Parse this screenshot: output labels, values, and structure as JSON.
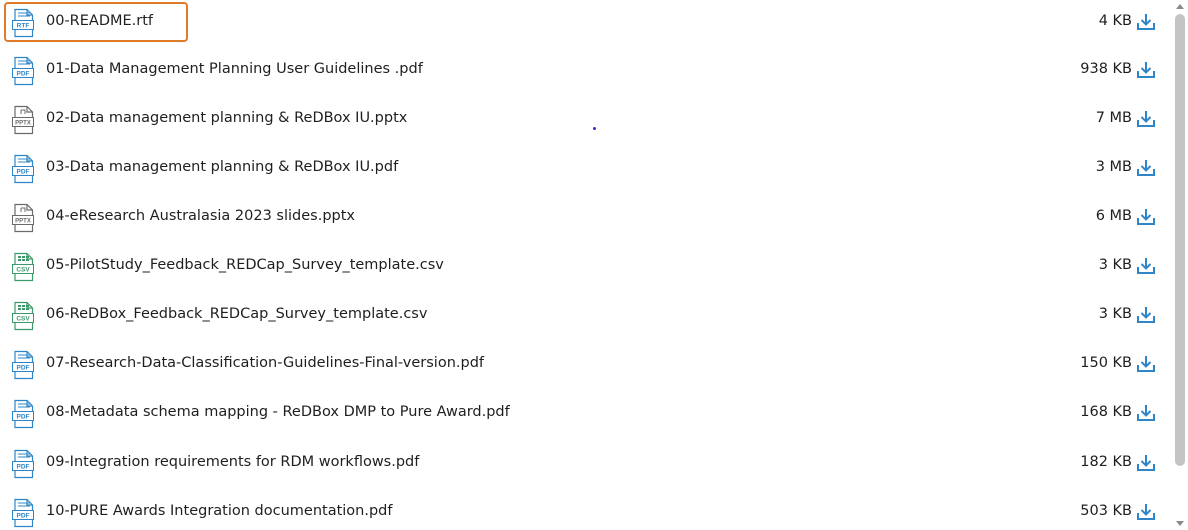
{
  "files": [
    {
      "name": "00-README.rtf",
      "size": "4 KB",
      "type": "RTF",
      "icon": "rtf-file-icon"
    },
    {
      "name": "01-Data Management Planning User Guidelines .pdf",
      "size": "938 KB",
      "type": "PDF",
      "icon": "pdf-file-icon"
    },
    {
      "name": "02-Data management planning & ReDBox IU.pptx",
      "size": "7 MB",
      "type": "PPTX",
      "icon": "pptx-file-icon"
    },
    {
      "name": "03-Data management planning & ReDBox IU.pdf",
      "size": "3 MB",
      "type": "PDF",
      "icon": "pdf-file-icon"
    },
    {
      "name": "04-eResearch Australasia 2023 slides.pptx",
      "size": "6 MB",
      "type": "PPTX",
      "icon": "pptx-file-icon"
    },
    {
      "name": "05-PilotStudy_Feedback_REDCap_Survey_template.csv",
      "size": "3 KB",
      "type": "CSV",
      "icon": "csv-file-icon"
    },
    {
      "name": "06-ReDBox_Feedback_REDCap_Survey_template.csv",
      "size": "3 KB",
      "type": "CSV",
      "icon": "csv-file-icon"
    },
    {
      "name": "07-Research-Data-Classification-Guidelines-Final-version.pdf",
      "size": "150 KB",
      "type": "PDF",
      "icon": "pdf-file-icon"
    },
    {
      "name": "08-Metadata schema mapping - ReDBox DMP to Pure Award.pdf",
      "size": "168 KB",
      "type": "PDF",
      "icon": "pdf-file-icon"
    },
    {
      "name": "09-Integration requirements for RDM workflows.pdf",
      "size": "182 KB",
      "type": "PDF",
      "icon": "pdf-file-icon"
    },
    {
      "name": "10-PURE Awards Integration documentation.pdf",
      "size": "503 KB",
      "type": "PDF",
      "icon": "pdf-file-icon"
    }
  ],
  "download_icon": "download-icon",
  "focused_item_index": 0,
  "colors": {
    "accent_blue": "#2e86c9",
    "icon_gray": "#6b6b6b",
    "csv_green": "#3c9a6a",
    "focus_orange": "#e07b29",
    "text": "#1f1f1f"
  }
}
